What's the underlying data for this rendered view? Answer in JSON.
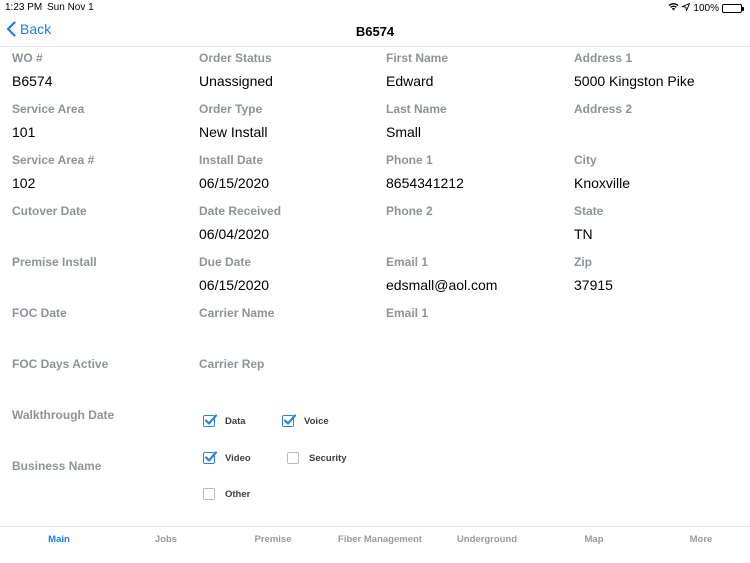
{
  "status_bar": {
    "time": "1:23 PM",
    "date": "Sun Nov 1",
    "battery": "100%",
    "battery_level": 1.0,
    "icons": [
      "wifi-icon",
      "location-icon",
      "battery-icon"
    ]
  },
  "nav": {
    "back_label": "Back",
    "title": "B6574"
  },
  "columns": [
    [
      {
        "label": "WO #",
        "value": "B6574"
      },
      {
        "label": "Service Area",
        "value": "101"
      },
      {
        "label": "Service Area #",
        "value": "102"
      },
      {
        "label": "Cutover Date",
        "value": ""
      },
      {
        "label": "Premise Install",
        "value": ""
      },
      {
        "label": "FOC Date",
        "value": ""
      },
      {
        "label": "FOC Days Active",
        "value": ""
      },
      {
        "label": "Walkthrough Date",
        "value": ""
      },
      {
        "label": "Business Name",
        "value": ""
      }
    ],
    [
      {
        "label": "Order Status",
        "value": "Unassigned"
      },
      {
        "label": "Order Type",
        "value": "New Install"
      },
      {
        "label": "Install Date",
        "value": "06/15/2020"
      },
      {
        "label": "Date Received",
        "value": "06/04/2020"
      },
      {
        "label": "Due Date",
        "value": "06/15/2020"
      },
      {
        "label": "Carrier Name",
        "value": ""
      },
      {
        "label": "Carrier Rep",
        "value": ""
      }
    ],
    [
      {
        "label": "First Name",
        "value": "Edward"
      },
      {
        "label": "Last Name",
        "value": "Small"
      },
      {
        "label": "Phone 1",
        "value": "8654341212"
      },
      {
        "label": "Phone 2",
        "value": ""
      },
      {
        "label": "Email 1",
        "value": "edsmall@aol.com"
      },
      {
        "label": "Email 1",
        "value": ""
      }
    ],
    [
      {
        "label": "Address 1",
        "value": "5000 Kingston Pike"
      },
      {
        "label": "Address 2",
        "value": ""
      },
      {
        "label": "City",
        "value": "Knoxville"
      },
      {
        "label": "State",
        "value": "TN"
      },
      {
        "label": "Zip",
        "value": "37915"
      }
    ]
  ],
  "services": [
    {
      "label": "Data",
      "checked": true
    },
    {
      "label": "Voice",
      "checked": true
    },
    {
      "label": "Video",
      "checked": true
    },
    {
      "label": "Security",
      "checked": false
    },
    {
      "label": "Other",
      "checked": false
    }
  ],
  "tabs": [
    {
      "label": "Main",
      "active": true
    },
    {
      "label": "Jobs",
      "active": false
    },
    {
      "label": "Premise",
      "active": false
    },
    {
      "label": "Fiber Management",
      "active": false
    },
    {
      "label": "Underground",
      "active": false
    },
    {
      "label": "Map",
      "active": false
    },
    {
      "label": "More",
      "active": false
    }
  ],
  "colors": {
    "accent": "#1a7ee6",
    "label": "#8e939b",
    "checkbox": "#2b84d6"
  }
}
